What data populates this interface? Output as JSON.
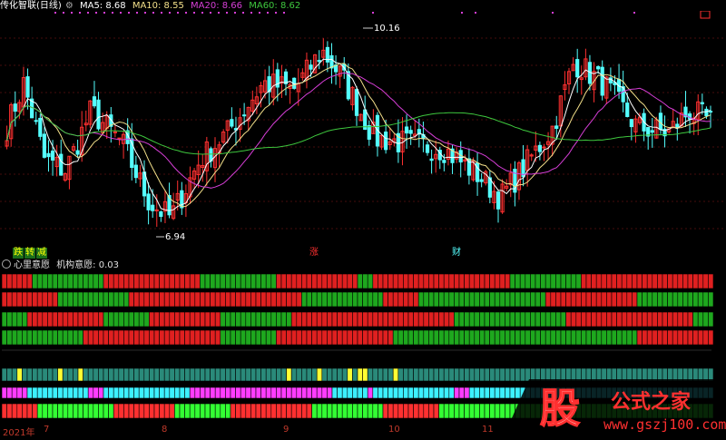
{
  "title": {
    "stock_name": "传化智联(日线)",
    "ma5_label": "MA5: 8.68",
    "ma10_label": "MA10: 8.55",
    "ma20_label": "MA20: 8.66",
    "ma60_label": "MA60: 8.62"
  },
  "colors": {
    "up": "#ff3030",
    "down": "#54ffff",
    "ma5": "#ffffff",
    "ma10": "#f3e08a",
    "ma20": "#d63ed6",
    "ma60": "#3ec83e",
    "grid": "#8b1a1a"
  },
  "annotations": {
    "high_label": "10.16",
    "low_label": "6.94"
  },
  "markers": {
    "m1": "跌",
    "m2": "转",
    "m3": "减",
    "m4": "涨",
    "m5": "财"
  },
  "sub_panel": {
    "name": "心里意愿",
    "value_label": "机构意愿: 0.03"
  },
  "x_axis": {
    "year": "2021年",
    "months": [
      "7",
      "8",
      "9",
      "10",
      "11"
    ]
  },
  "watermark": {
    "logo_char": "股",
    "brand": "公式之家",
    "url": "www.gszj100.com"
  },
  "chart_data": {
    "type": "candlestick",
    "price_high": 10.16,
    "price_low": 6.94,
    "ma_latest": {
      "MA5": 8.68,
      "MA10": 8.55,
      "MA20": 8.66,
      "MA60": 8.62
    }
  }
}
